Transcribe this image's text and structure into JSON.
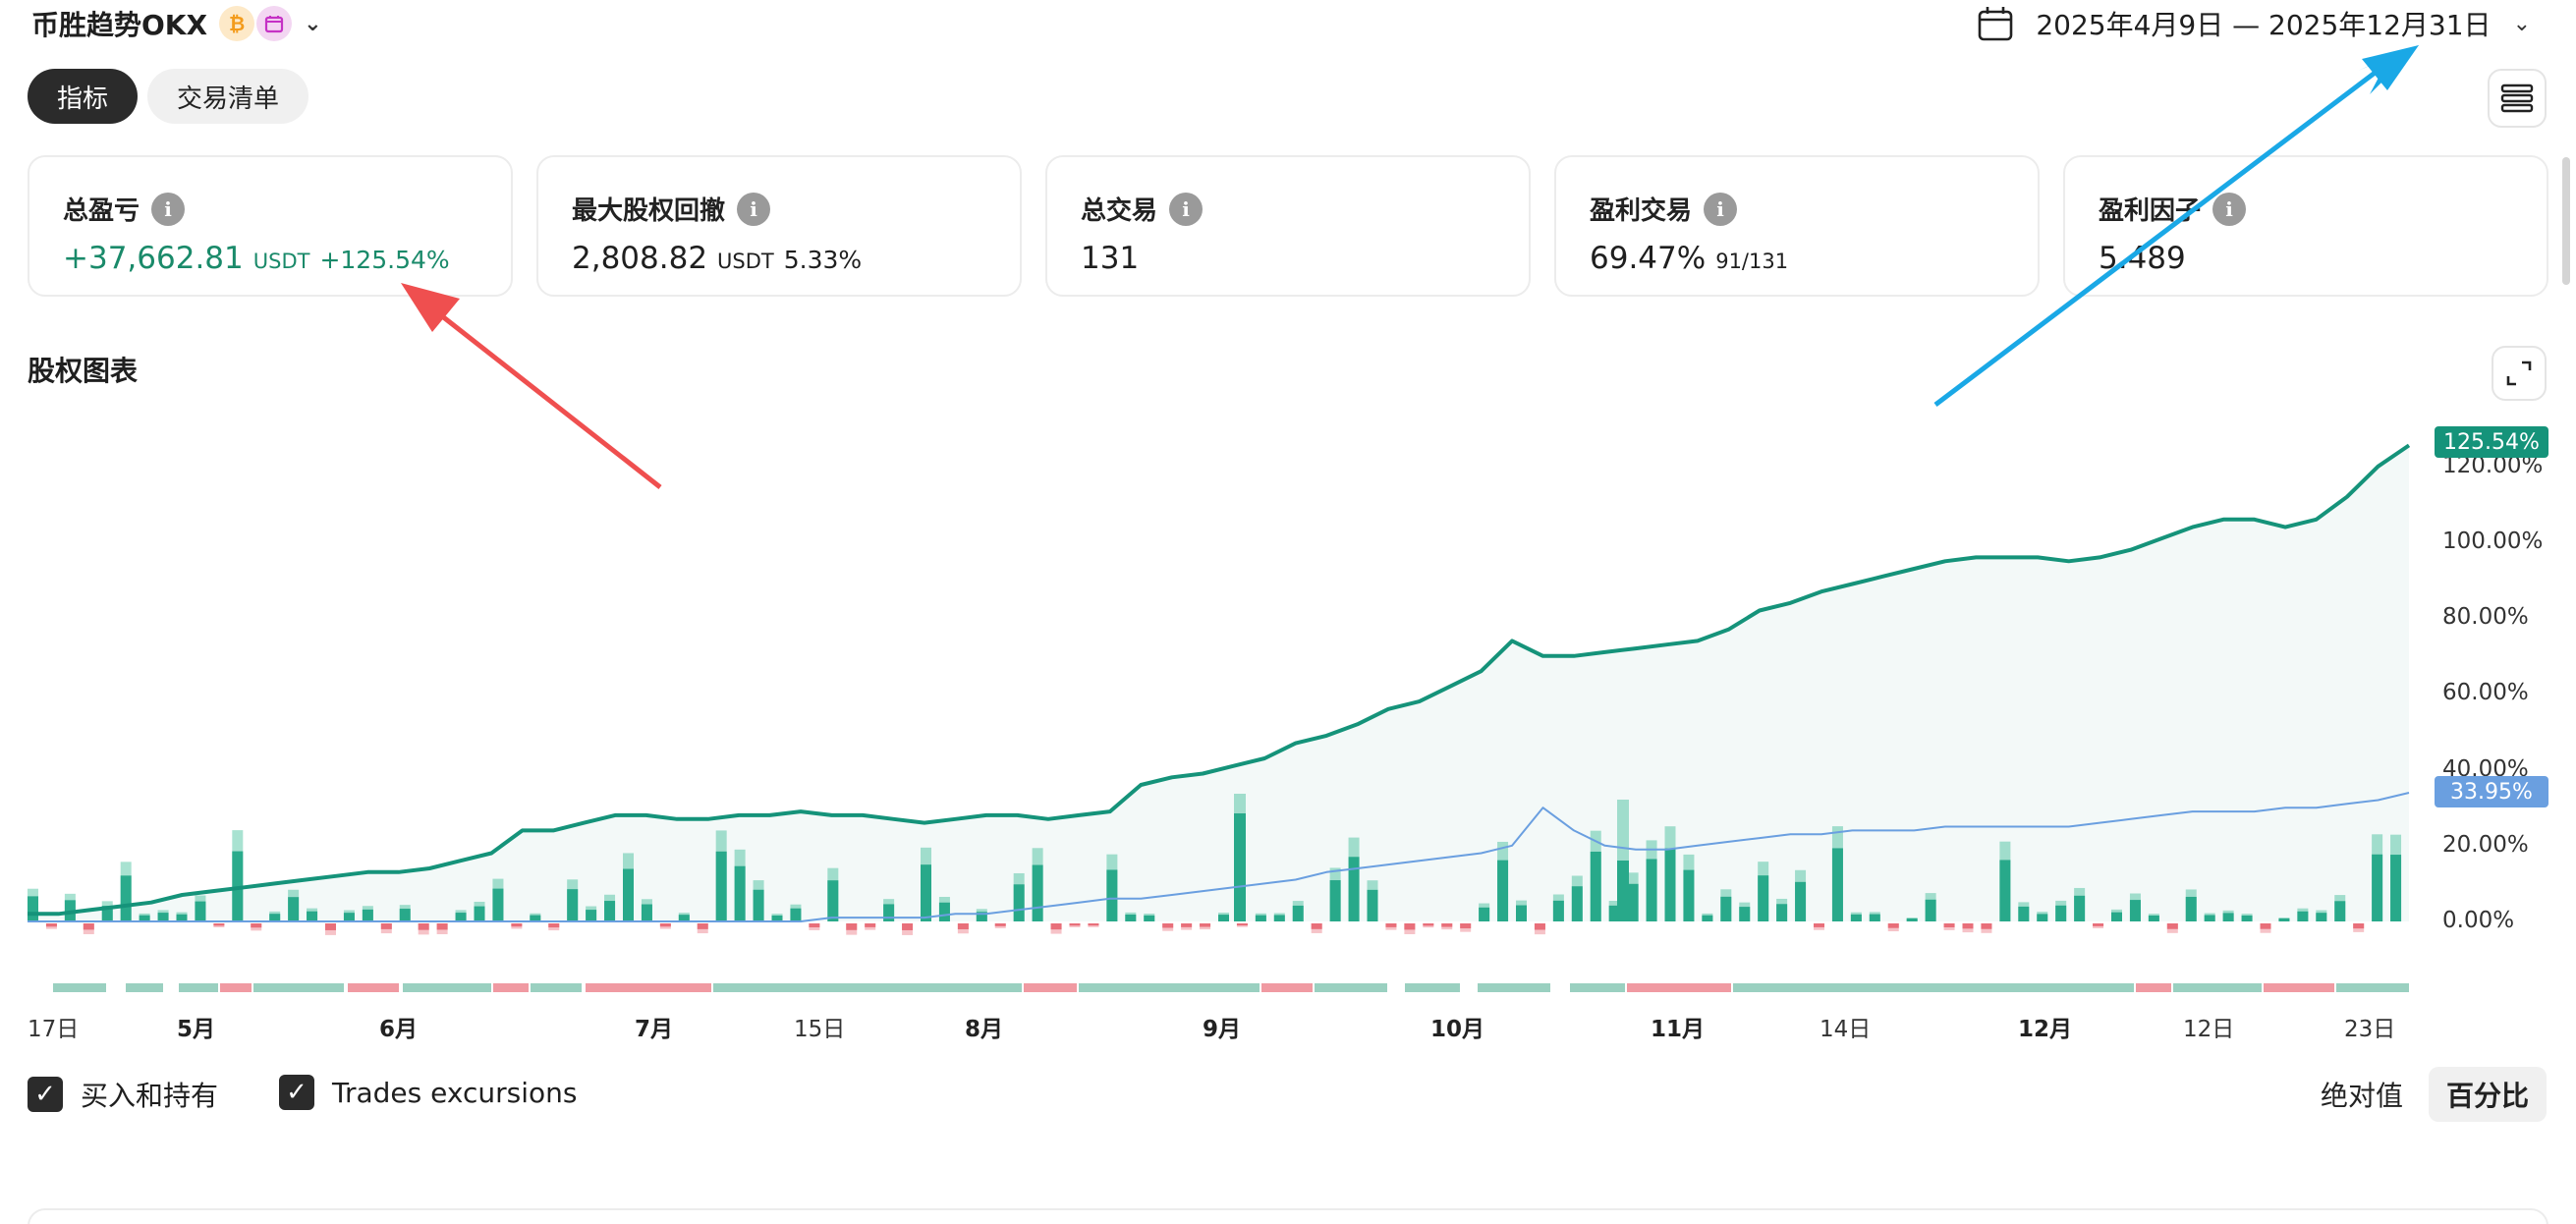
{
  "header": {
    "strategy_name": "币胜趋势OKX",
    "badge_1": "₿",
    "badge_2_icon": "calendar-icon",
    "date_range": "2025年4月9日 — 2025年12月31日"
  },
  "tabs": [
    {
      "label": "指标",
      "active": true
    },
    {
      "label": "交易清单",
      "active": false
    }
  ],
  "metrics": {
    "total_pnl": {
      "title": "总盈亏",
      "value": "+37,662.81",
      "unit": "USDT",
      "pct": "+125.54%"
    },
    "max_drawdown": {
      "title": "最大股权回撤",
      "value": "2,808.82",
      "unit": "USDT",
      "pct": "5.33%"
    },
    "total_trades": {
      "title": "总交易",
      "value": "131"
    },
    "profitable_trades": {
      "title": "盈利交易",
      "value": "69.47%",
      "sub": "91/131"
    },
    "profit_factor": {
      "title": "盈利因子",
      "value": "5.489"
    }
  },
  "chart_title": "股权图表",
  "chart_data": {
    "type": "line",
    "y_axis_labels": [
      "120.00%",
      "100.00%",
      "80.00%",
      "60.00%",
      "40.00%",
      "20.00%",
      "0.00%"
    ],
    "x_axis_labels": [
      {
        "label": "17日",
        "bold": false
      },
      {
        "label": "5月",
        "bold": true
      },
      {
        "label": "6月",
        "bold": true
      },
      {
        "label": "7月",
        "bold": true
      },
      {
        "label": "15日",
        "bold": false
      },
      {
        "label": "8月",
        "bold": true
      },
      {
        "label": "9月",
        "bold": true
      },
      {
        "label": "10月",
        "bold": true
      },
      {
        "label": "11月",
        "bold": true
      },
      {
        "label": "14日",
        "bold": false
      },
      {
        "label": "12月",
        "bold": true
      },
      {
        "label": "12日",
        "bold": false
      },
      {
        "label": "23日",
        "bold": false
      }
    ],
    "ylim": [
      0,
      130
    ],
    "series": [
      {
        "name": "",
        "color": "#15937a",
        "last_label": "125.54%",
        "values": [
          2,
          2,
          3,
          4,
          5,
          7,
          8,
          9,
          10,
          11,
          12,
          13,
          13,
          14,
          16,
          18,
          24,
          24,
          26,
          28,
          28,
          27,
          27,
          28,
          28,
          29,
          28,
          28,
          27,
          26,
          27,
          28,
          28,
          27,
          28,
          29,
          36,
          38,
          39,
          41,
          43,
          47,
          49,
          52,
          56,
          58,
          62,
          66,
          74,
          70,
          70,
          71,
          72,
          73,
          74,
          77,
          82,
          84,
          87,
          89,
          91,
          93,
          95,
          96,
          96,
          96,
          95,
          96,
          98,
          101,
          104,
          106,
          106,
          104,
          106,
          112,
          120,
          125.54
        ]
      },
      {
        "name": "",
        "color": "#6a9fe0",
        "last_label": "33.95%",
        "values": [
          0,
          0,
          0,
          0,
          0,
          0,
          0,
          0,
          0,
          0,
          0,
          0,
          0,
          0,
          0,
          0,
          0,
          0,
          0,
          0,
          0,
          0,
          0,
          0,
          0,
          0,
          1,
          1,
          1,
          1,
          2,
          2,
          3,
          4,
          5,
          6,
          6,
          7,
          8,
          9,
          10,
          11,
          13,
          14,
          15,
          16,
          17,
          18,
          20,
          30,
          24,
          20,
          19,
          19,
          20,
          21,
          22,
          23,
          23,
          24,
          24,
          24,
          25,
          25,
          25,
          25,
          25,
          26,
          27,
          28,
          29,
          29,
          29,
          30,
          30,
          31,
          32,
          33.95
        ]
      }
    ]
  },
  "legend": {
    "buy_hold": "买入和持有",
    "trades_excursions": "Trades excursions"
  },
  "toggle": {
    "absolute": "绝对值",
    "percent": "百分比"
  },
  "colors": {
    "accent_green": "#15937a",
    "profit_bar": "#2aab8c",
    "loss_bar": "#e86f7a",
    "buyhold_line": "#6a9fe0",
    "dark": "#2b2b2b"
  }
}
